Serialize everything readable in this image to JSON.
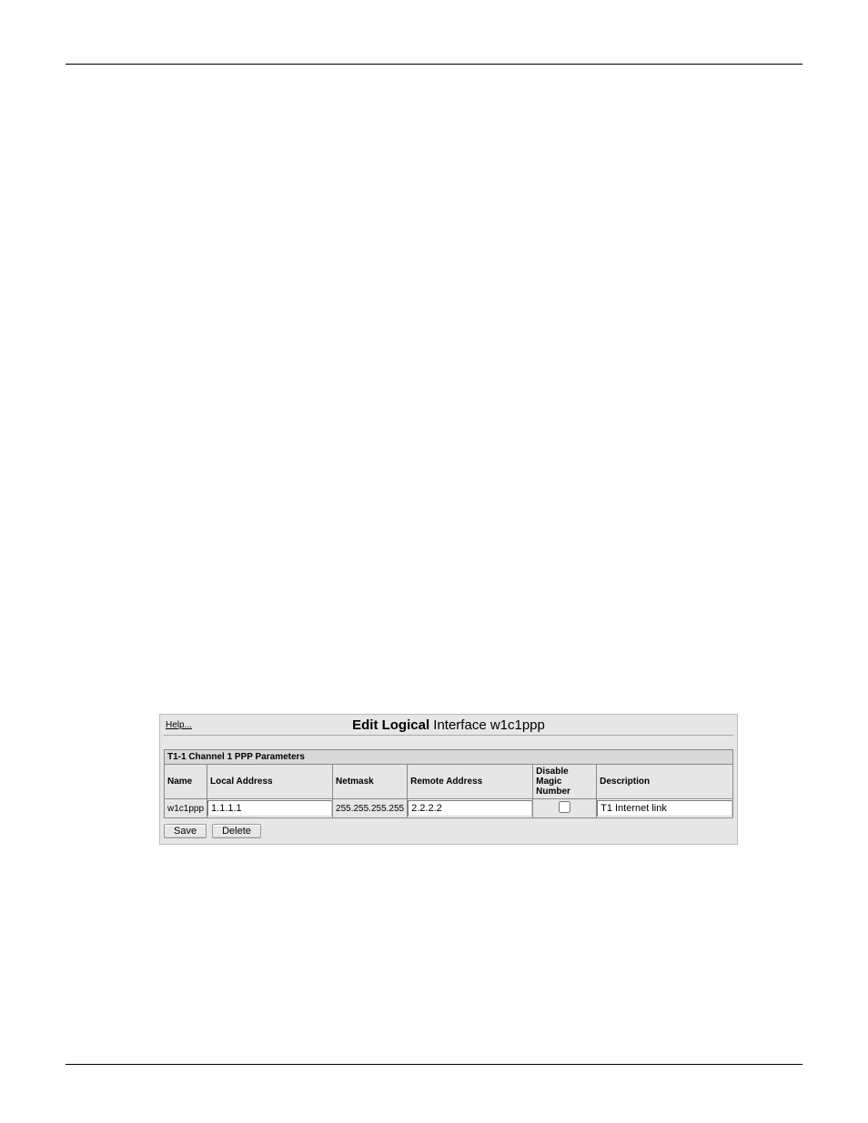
{
  "header": {
    "left": "",
    "right": ""
  },
  "panel": {
    "help_label": "Help...",
    "title_bold": "Edit Logical",
    "title_rest": " Interface w1c1ppp",
    "group_header": "T1-1 Channel 1 PPP Parameters",
    "columns": {
      "name": "Name",
      "local": "Local Address",
      "netmask": "Netmask",
      "remote": "Remote Address",
      "disable_magic": "Disable Magic Number",
      "description": "Description"
    },
    "row": {
      "name": "w1c1ppp",
      "local": "1.1.1.1",
      "netmask": "255.255.255.255",
      "remote": "2.2.2.2",
      "disable_magic_checked": false,
      "description": "T1 Internet link"
    },
    "buttons": {
      "save": "Save",
      "delete": "Delete"
    }
  },
  "footer": {
    "left": "",
    "right": ""
  }
}
